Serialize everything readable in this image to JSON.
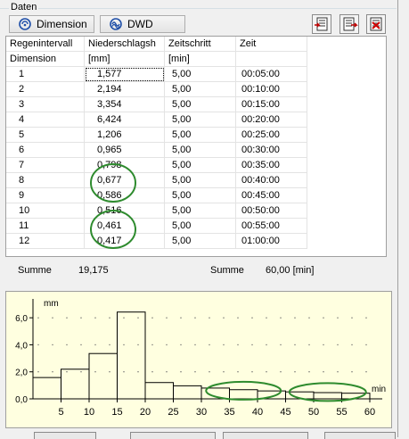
{
  "panel": {
    "title": "Daten"
  },
  "toolbar": {
    "dimension_label": "Dimension",
    "dwd_label": "DWD"
  },
  "table": {
    "headers": [
      "Regenintervall",
      "Niederschlagsh",
      "Zeitschritt",
      "Zeit"
    ],
    "units": [
      "Dimension",
      "[mm]",
      "[min]",
      ""
    ],
    "rows": [
      [
        "1",
        "1,577",
        "5,00",
        "00:05:00"
      ],
      [
        "2",
        "2,194",
        "5,00",
        "00:10:00"
      ],
      [
        "3",
        "3,354",
        "5,00",
        "00:15:00"
      ],
      [
        "4",
        "6,424",
        "5,00",
        "00:20:00"
      ],
      [
        "5",
        "1,206",
        "5,00",
        "00:25:00"
      ],
      [
        "6",
        "0,965",
        "5,00",
        "00:30:00"
      ],
      [
        "7",
        "0,798",
        "5,00",
        "00:35:00"
      ],
      [
        "8",
        "0,677",
        "5,00",
        "00:40:00"
      ],
      [
        "9",
        "0,586",
        "5,00",
        "00:45:00"
      ],
      [
        "10",
        "0,516",
        "5,00",
        "00:50:00"
      ],
      [
        "11",
        "0,461",
        "5,00",
        "00:55:00"
      ],
      [
        "12",
        "0,417",
        "5,00",
        "01:00:00"
      ]
    ]
  },
  "summary": {
    "label1": "Summe",
    "value1": "19,175",
    "label2": "Summe",
    "value2": "60,00 [min]"
  },
  "colors": {
    "highlight_ellipse": "#2e8b2e",
    "chart_background": "#ffffe0"
  },
  "chart_data": {
    "type": "bar",
    "ylabel": "mm",
    "xlabel": "min",
    "x_ticks": [
      5,
      10,
      15,
      20,
      25,
      30,
      35,
      40,
      45,
      50,
      55,
      60
    ],
    "y_ticks": [
      "0,0",
      "2,0",
      "4,0",
      "6,0"
    ],
    "ylim": [
      0,
      7
    ],
    "xlim": [
      0,
      60
    ],
    "interval_minutes": 5,
    "values": [
      1.577,
      2.194,
      3.354,
      6.424,
      1.206,
      0.965,
      0.798,
      0.677,
      0.586,
      0.516,
      0.461,
      0.417
    ],
    "grid": "dotted"
  }
}
